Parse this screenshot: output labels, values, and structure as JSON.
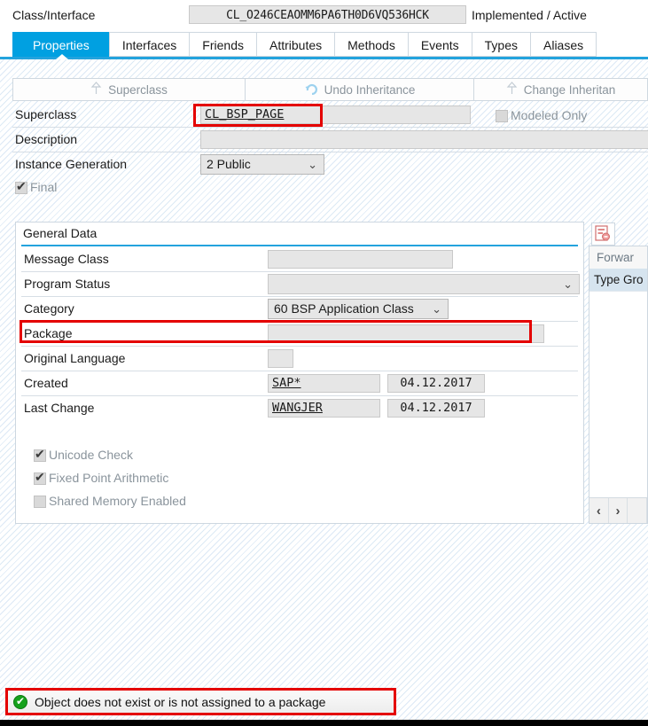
{
  "header": {
    "label": "Class/Interface",
    "class_name": "CL_O246CEAOMM6PA6TH0D6VQ536HCK",
    "status": "Implemented / Active"
  },
  "tabs": [
    {
      "label": "Properties",
      "active": true
    },
    {
      "label": "Interfaces",
      "active": false
    },
    {
      "label": "Friends",
      "active": false
    },
    {
      "label": "Attributes",
      "active": false
    },
    {
      "label": "Methods",
      "active": false
    },
    {
      "label": "Events",
      "active": false
    },
    {
      "label": "Types",
      "active": false
    },
    {
      "label": "Aliases",
      "active": false
    }
  ],
  "toolbar": {
    "superclass_button": "Superclass",
    "undo_inheritance_button": "Undo Inheritance",
    "change_inheritance_button": "Change Inheritan"
  },
  "inheritance": {
    "superclass_label": "Superclass",
    "superclass_value": "CL_BSP_PAGE",
    "modeled_only_label": "Modeled Only",
    "modeled_only_checked": false,
    "description_label": "Description",
    "description_value": "",
    "instance_generation_label": "Instance Generation",
    "instance_generation_value": "2 Public",
    "final_label": "Final",
    "final_checked": true
  },
  "general_data": {
    "title": "General Data",
    "rows": [
      {
        "label": "Message Class",
        "value": ""
      },
      {
        "label": "Program Status",
        "value": ""
      },
      {
        "label": "Category",
        "value": "60 BSP Application Class"
      },
      {
        "label": "Package",
        "value": ""
      },
      {
        "label": "Original Language",
        "value": ""
      },
      {
        "label": "Created",
        "value": "SAP*",
        "date": "04.12.2017"
      },
      {
        "label": "Last Change",
        "value": "WANGJER",
        "date": "04.12.2017"
      }
    ],
    "checkboxes": [
      {
        "label": "Unicode Check",
        "checked": true
      },
      {
        "label": "Fixed Point Arithmetic",
        "checked": true
      },
      {
        "label": "Shared Memory Enabled",
        "checked": false
      }
    ]
  },
  "side_panel": {
    "header": "Forwar",
    "selected_row": "Type Gro",
    "prev_label": "‹",
    "next_label": "›"
  },
  "status_bar": {
    "message": "Object does not exist or is not assigned to a package",
    "icon": "success-check-icon"
  },
  "annotations": {
    "accent_color": "#00a0e1",
    "highlight_color": "#e40000"
  }
}
